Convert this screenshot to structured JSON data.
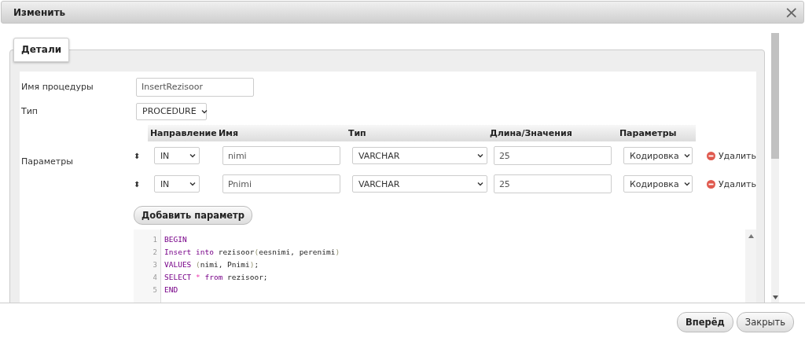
{
  "dialog": {
    "title": "Изменить",
    "close": "×",
    "tab": "Детали",
    "fields": [
      {
        "label": "Имя процедуры",
        "kind": "text",
        "value": "InsertRezisoor"
      },
      {
        "label": "Тип",
        "kind": "select",
        "value": "PROCEDURE"
      }
    ],
    "parameters": {
      "label": "Параметры",
      "columns": [
        "Направление",
        "Имя",
        "Тип",
        "Длина/Значения",
        "Параметры"
      ],
      "rows": [
        {
          "handle": "⬍",
          "direction": "IN",
          "name": "nimi",
          "type": "VARCHAR",
          "length": "25",
          "options": "Кодировка",
          "delete": "Удалить"
        },
        {
          "handle": "⬍",
          "direction": "IN",
          "name": "Pnimi",
          "type": "VARCHAR",
          "length": "25",
          "options": "Кодировка",
          "delete": "Удалить"
        }
      ],
      "add_button": "Добавить параметр"
    },
    "code": {
      "lines": [
        {
          "number": "1",
          "tokens": [
            {
              "kind": "keyword",
              "text": "BEGIN"
            }
          ]
        },
        {
          "number": "2",
          "tokens": [
            {
              "kind": "keyword",
              "text": "Insert"
            },
            {
              "kind": "keyword",
              "text": " into"
            },
            {
              "kind": "plain",
              "text": " rezisoor"
            },
            {
              "kind": "bracket",
              "text": "("
            },
            {
              "kind": "plain",
              "text": "eesnimi, perenimi"
            },
            {
              "kind": "bracket",
              "text": ")"
            }
          ]
        },
        {
          "number": "3",
          "tokens": [
            {
              "kind": "keyword",
              "text": "VALUES"
            },
            {
              "kind": "bracket",
              "text": " ("
            },
            {
              "kind": "plain",
              "text": "nimi, Pnimi"
            },
            {
              "kind": "bracket",
              "text": ")"
            },
            {
              "kind": "plain",
              "text": ";"
            }
          ]
        },
        {
          "number": "4",
          "tokens": [
            {
              "kind": "keyword",
              "text": "SELECT"
            },
            {
              "kind": "operator",
              "text": " *"
            },
            {
              "kind": "keyword",
              "text": " from"
            },
            {
              "kind": "plain",
              "text": " rezisoor;"
            }
          ]
        },
        {
          "number": "5",
          "tokens": [
            {
              "kind": "keyword",
              "text": "END"
            }
          ]
        }
      ]
    },
    "buttons": [
      {
        "label": "Вперёд",
        "primary": true
      },
      {
        "label": "Закрыть",
        "primary": false
      }
    ]
  }
}
